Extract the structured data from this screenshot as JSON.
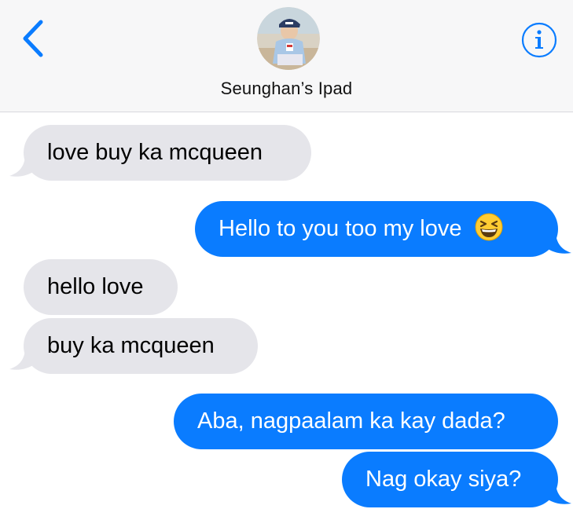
{
  "header": {
    "contact_name": "Seunghan’s Ipad",
    "back_icon": "chevron-left-icon",
    "info_icon": "info-circle-icon",
    "accent_color": "#0a7cff"
  },
  "messages": [
    {
      "direction": "incoming",
      "text": "love buy ka mcqueen"
    },
    {
      "direction": "outgoing",
      "text": "Hello to you too my love",
      "emoji": "grinning-squinting-face"
    },
    {
      "direction": "incoming",
      "text": "hello love"
    },
    {
      "direction": "incoming",
      "text": "buy ka mcqueen"
    },
    {
      "direction": "outgoing",
      "text": "Aba, nagpaalam ka kay dada?"
    },
    {
      "direction": "outgoing",
      "text": "Nag okay siya?"
    }
  ],
  "colors": {
    "incoming_bubble": "#e5e5ea",
    "outgoing_bubble": "#0a7cff",
    "header_bg": "#f7f7f8"
  }
}
